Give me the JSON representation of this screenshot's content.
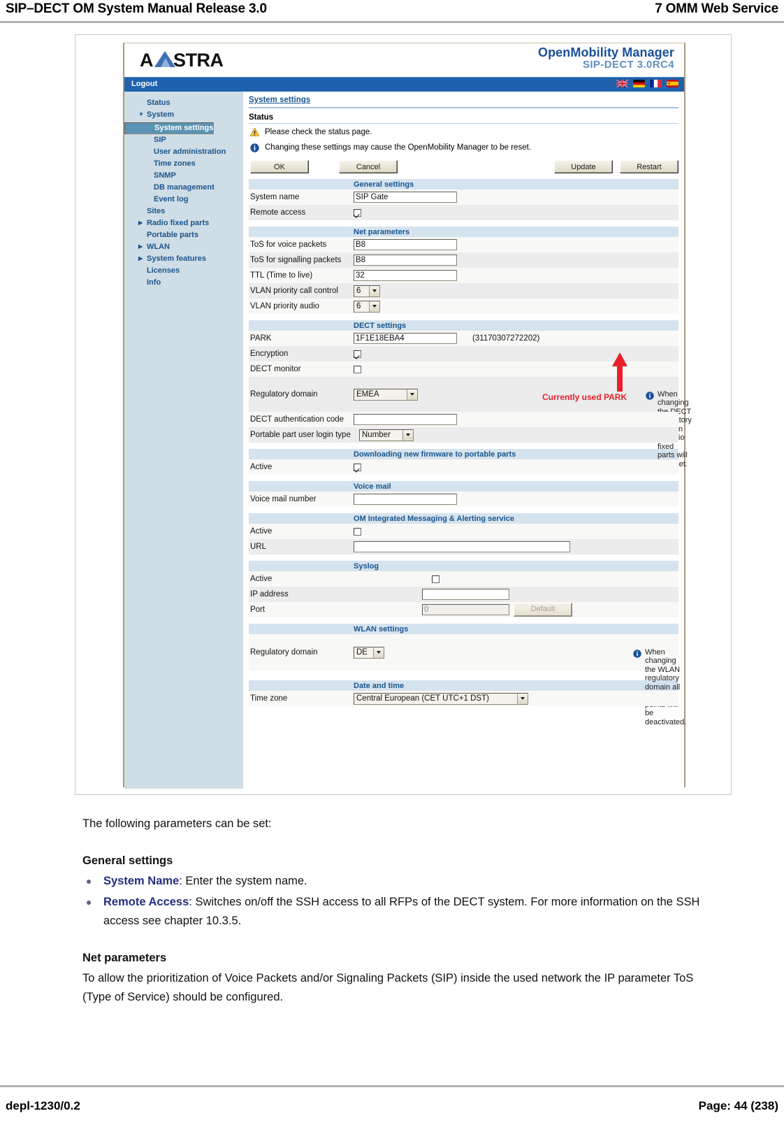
{
  "document": {
    "header_left": "SIP–DECT OM System Manual Release 3.0",
    "header_right": "7 OMM Web Service",
    "footer_left": "depl-1230/0.2",
    "footer_right": "Page: 44 (238)"
  },
  "app": {
    "brand": "AASTRA",
    "product_title": "OpenMobility Manager",
    "product_version": "SIP-DECT 3.0RC4",
    "logout_label": "Logout",
    "flags": [
      {
        "name": "flag-uk",
        "label": "English"
      },
      {
        "name": "flag-de",
        "label": "Deutsch"
      },
      {
        "name": "flag-fr",
        "label": "Français"
      },
      {
        "name": "flag-es",
        "label": "Español"
      }
    ],
    "sidebar": {
      "items": [
        {
          "label": "Status",
          "level": 0,
          "caret": "",
          "selected": false
        },
        {
          "label": "System",
          "level": 0,
          "caret": "▼",
          "selected": false
        },
        {
          "label": "System settings",
          "level": 1,
          "caret": "",
          "selected": true
        },
        {
          "label": "SIP",
          "level": 1,
          "caret": "",
          "selected": false
        },
        {
          "label": "User administration",
          "level": 1,
          "caret": "",
          "selected": false
        },
        {
          "label": "Time zones",
          "level": 1,
          "caret": "",
          "selected": false
        },
        {
          "label": "SNMP",
          "level": 1,
          "caret": "",
          "selected": false
        },
        {
          "label": "DB management",
          "level": 1,
          "caret": "",
          "selected": false
        },
        {
          "label": "Event log",
          "level": 1,
          "caret": "",
          "selected": false
        },
        {
          "label": "Sites",
          "level": 0,
          "caret": "",
          "selected": false
        },
        {
          "label": "Radio fixed parts",
          "level": 0,
          "caret": "▶",
          "selected": false
        },
        {
          "label": "Portable parts",
          "level": 0,
          "caret": "",
          "selected": false
        },
        {
          "label": "WLAN",
          "level": 0,
          "caret": "▶",
          "selected": false
        },
        {
          "label": "System features",
          "level": 0,
          "caret": "▶",
          "selected": false
        },
        {
          "label": "Licenses",
          "level": 0,
          "caret": "",
          "selected": false
        },
        {
          "label": "Info",
          "level": 0,
          "caret": "",
          "selected": false
        }
      ]
    },
    "page": {
      "title": "System settings",
      "status_heading": "Status",
      "warning_message": "Please check the status page.",
      "info_message": "Changing these settings may cause the OpenMobility Manager to be reset.",
      "buttons": {
        "ok": "OK",
        "cancel": "Cancel",
        "update": "Update",
        "restart": "Restart"
      }
    },
    "sections": {
      "general": {
        "title": "General settings",
        "system_name_label": "System name",
        "system_name_value": "SIP Gate",
        "remote_access_label": "Remote access",
        "remote_access_checked": true
      },
      "net": {
        "title": "Net parameters",
        "tos_voice_label": "ToS for voice packets",
        "tos_voice_value": "B8",
        "tos_signalling_label": "ToS for signalling packets",
        "tos_signalling_value": "B8",
        "ttl_label": "TTL (Time to live)",
        "ttl_value": "32",
        "vlan_call_label": "VLAN priority call control",
        "vlan_call_value": "6",
        "vlan_audio_label": "VLAN priority audio",
        "vlan_audio_value": "6"
      },
      "dect": {
        "title": "DECT settings",
        "park_label": "PARK",
        "park_value": "1F1E18EBA4",
        "park_decimal": "(31170307272202)",
        "encryption_label": "Encryption",
        "encryption_checked": true,
        "monitor_label": "DECT monitor",
        "monitor_checked": false,
        "regulatory_label": "Regulatory domain",
        "regulatory_value": "EMEA",
        "auth_code_label": "DECT authentication code",
        "auth_code_value": "",
        "login_type_label": "Portable part user login type",
        "login_type_value": "Number",
        "annotation": "Currently used PARK",
        "annotation_color": "#e8202a",
        "note": "When changing the DECT regulatory domain all radio fixed parts will be reset."
      },
      "firmware": {
        "title": "Downloading new firmware to portable parts",
        "active_label": "Active",
        "active_checked": true
      },
      "voicemail": {
        "title": "Voice mail",
        "number_label": "Voice mail number",
        "number_value": ""
      },
      "messaging": {
        "title": "OM Integrated Messaging & Alerting service",
        "active_label": "Active",
        "active_checked": false,
        "url_label": "URL",
        "url_value": ""
      },
      "syslog": {
        "title": "Syslog",
        "active_label": "Active",
        "active_checked": false,
        "ip_label": "IP address",
        "ip_value": "",
        "port_label": "Port",
        "port_value": "0",
        "default_button": "Default"
      },
      "wlan": {
        "title": "WLAN settings",
        "regulatory_label": "Regulatory domain",
        "regulatory_value": "DE",
        "note": "When changing the WLAN regulatory domain all access points will be deactivated."
      },
      "datetime": {
        "title": "Date and time",
        "timezone_label": "Time zone",
        "timezone_value": "Central European (CET UTC+1 DST)"
      }
    }
  },
  "prose": {
    "intro": "The following parameters can be set:",
    "general_heading": "General settings",
    "bullet1_kw": "System Name",
    "bullet1_rest": ": Enter the system name.",
    "bullet2_kw": "Remote Access",
    "bullet2_rest": ": Switches on/off the SSH access to all RFPs of the DECT system. For more information on the SSH access see chapter 10.3.5.",
    "net_heading": "Net parameters",
    "net_body": "To allow the prioritization of Voice Packets and/or Signaling Packets (SIP) inside the used network the IP parameter ToS (Type of Service) should be configured."
  }
}
